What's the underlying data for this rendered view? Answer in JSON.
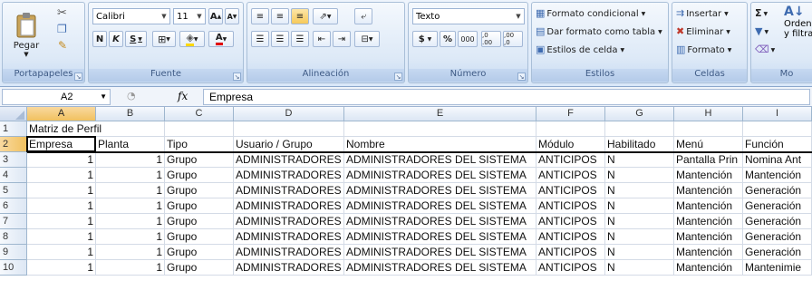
{
  "clipboard": {
    "paste": "Pegar",
    "label": "Portapapeles"
  },
  "font": {
    "name": "Calibri",
    "size": "11",
    "bold": "N",
    "italic": "K",
    "underline": "S",
    "grow": "A",
    "shrink": "A",
    "label": "Fuente"
  },
  "alignment": {
    "label": "Alineación"
  },
  "number": {
    "format": "Texto",
    "currency": "$",
    "percent": "%",
    "thousands": "000",
    "inc_dec": ",0 .00",
    "dec_dec": ",00 ,0",
    "label": "Número"
  },
  "styles": {
    "conditional": "Formato condicional",
    "as_table": "Dar formato como tabla",
    "cell_styles": "Estilos de celda",
    "label": "Estilos"
  },
  "cells_group": {
    "insert": "Insertar",
    "delete": "Eliminar",
    "format": "Formato",
    "label": "Celdas"
  },
  "editing": {
    "sort": "Ordenar",
    "filter": "y filtrar",
    "label": "Mo"
  },
  "formula_bar": {
    "name_box": "A2",
    "fx": "fx",
    "value": "Empresa"
  },
  "columns": [
    "A",
    "B",
    "C",
    "D",
    "E",
    "F",
    "G",
    "H",
    "I"
  ],
  "rows": [
    {
      "num": "1",
      "cells": [
        "Matriz de Perfil",
        "",
        "",
        "",
        "",
        "",
        "",
        "",
        ""
      ]
    },
    {
      "num": "2",
      "cells": [
        "Empresa",
        "Planta",
        "Tipo",
        "Usuario / Grupo",
        "Nombre",
        "Módulo",
        "Habilitado",
        "Menú",
        "Función"
      ]
    },
    {
      "num": "3",
      "cells": [
        "1",
        "1",
        "Grupo",
        "ADMINISTRADORES",
        "ADMINISTRADORES DEL SISTEMA",
        "ANTICIPOS",
        "N",
        "Pantalla Prin",
        "Nomina Ant"
      ]
    },
    {
      "num": "4",
      "cells": [
        "1",
        "1",
        "Grupo",
        "ADMINISTRADORES",
        "ADMINISTRADORES DEL SISTEMA",
        "ANTICIPOS",
        "N",
        "Mantención",
        "Mantención"
      ]
    },
    {
      "num": "5",
      "cells": [
        "1",
        "1",
        "Grupo",
        "ADMINISTRADORES",
        "ADMINISTRADORES DEL SISTEMA",
        "ANTICIPOS",
        "N",
        "Mantención",
        "Generación"
      ]
    },
    {
      "num": "6",
      "cells": [
        "1",
        "1",
        "Grupo",
        "ADMINISTRADORES",
        "ADMINISTRADORES DEL SISTEMA",
        "ANTICIPOS",
        "N",
        "Mantención",
        "Generación"
      ]
    },
    {
      "num": "7",
      "cells": [
        "1",
        "1",
        "Grupo",
        "ADMINISTRADORES",
        "ADMINISTRADORES DEL SISTEMA",
        "ANTICIPOS",
        "N",
        "Mantención",
        "Generación"
      ]
    },
    {
      "num": "8",
      "cells": [
        "1",
        "1",
        "Grupo",
        "ADMINISTRADORES",
        "ADMINISTRADORES DEL SISTEMA",
        "ANTICIPOS",
        "N",
        "Mantención",
        "Generación"
      ]
    },
    {
      "num": "9",
      "cells": [
        "1",
        "1",
        "Grupo",
        "ADMINISTRADORES",
        "ADMINISTRADORES DEL SISTEMA",
        "ANTICIPOS",
        "N",
        "Mantención",
        "Generación"
      ]
    },
    {
      "num": "10",
      "cells": [
        "1",
        "1",
        "Grupo",
        "ADMINISTRADORES",
        "ADMINISTRADORES DEL SISTEMA",
        "ANTICIPOS",
        "N",
        "Mantención",
        "Mantenimie"
      ]
    }
  ],
  "selection": {
    "column": "A",
    "row": "2"
  },
  "icons": {
    "paste": "clipboard-icon",
    "cut": "scissors-icon",
    "copy": "copy-icon",
    "format_painter": "brush-icon",
    "sum": "sigma-icon",
    "sort": "sort-az-icon"
  }
}
